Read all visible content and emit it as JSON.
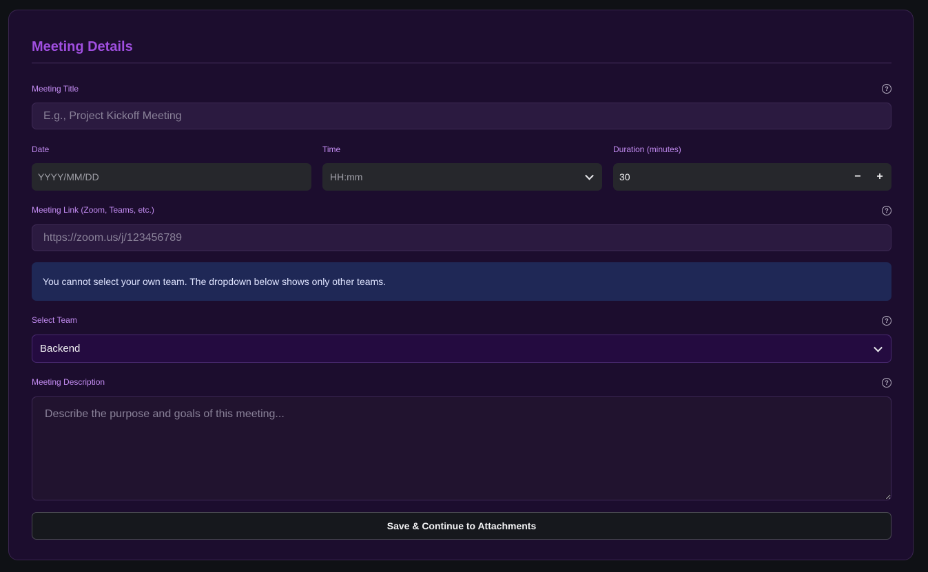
{
  "form": {
    "section_title": "Meeting Details",
    "title": {
      "label": "Meeting Title",
      "placeholder": "E.g., Project Kickoff Meeting",
      "help_icon": "question-circle-icon"
    },
    "date": {
      "label": "Date",
      "placeholder": "YYYY/MM/DD"
    },
    "time": {
      "label": "Time",
      "placeholder": "HH:mm",
      "icon": "chevron-down-icon"
    },
    "duration": {
      "label": "Duration (minutes)",
      "value": "30",
      "decrement": "−",
      "increment": "+"
    },
    "link": {
      "label": "Meeting Link (Zoom, Teams, etc.)",
      "placeholder": "https://zoom.us/j/123456789",
      "help_icon": "question-circle-icon"
    },
    "info_message": "You cannot select your own team. The dropdown below shows only other teams.",
    "team": {
      "label": "Select Team",
      "selected": "Backend",
      "help_icon": "question-circle-icon",
      "icon": "chevron-down-icon"
    },
    "description": {
      "label": "Meeting Description",
      "placeholder": "Describe the purpose and goals of this meeting...",
      "help_icon": "question-circle-icon"
    },
    "submit_label": "Save & Continue to Attachments"
  },
  "colors": {
    "accent": "#a04fe0",
    "label": "#c38cf2",
    "card_bg": "#1c0d2e",
    "info_bg": "#1f2856",
    "page_bg": "#0f1115"
  }
}
